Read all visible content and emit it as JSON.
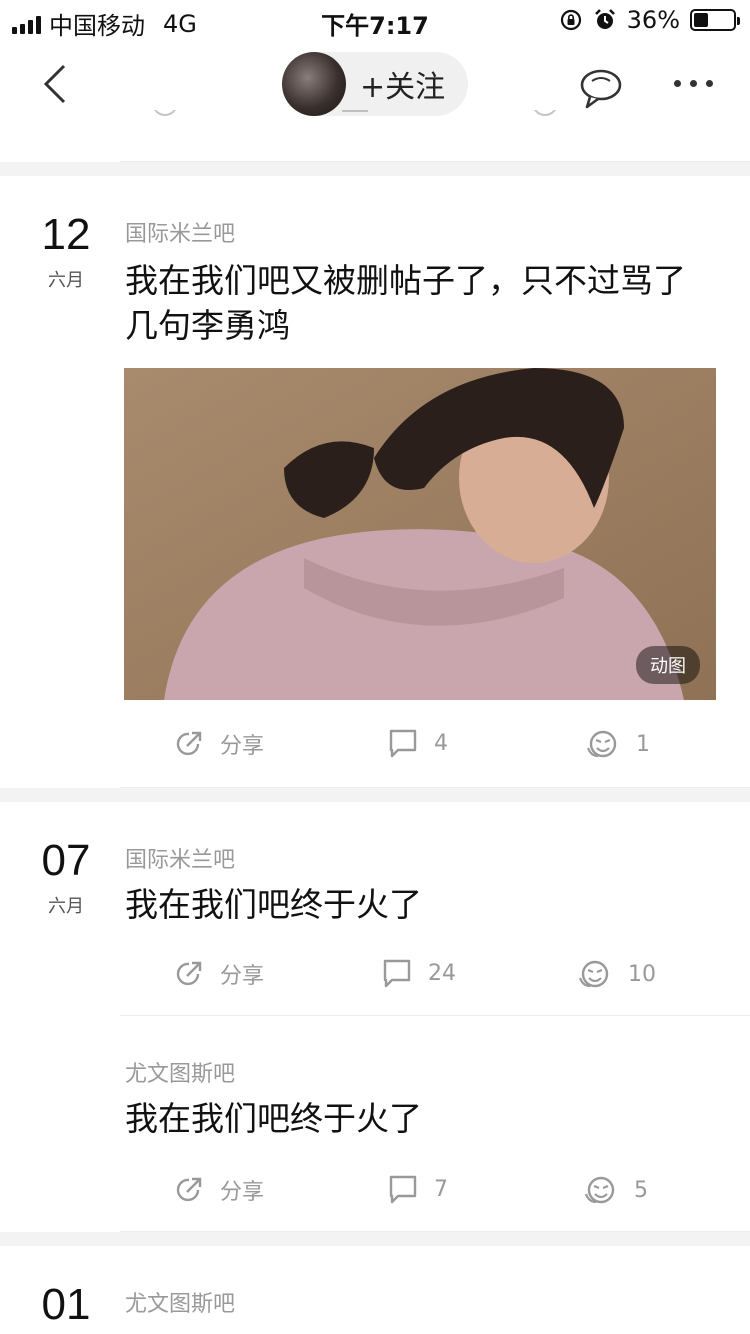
{
  "status_bar": {
    "carrier": "中国移动",
    "network": "4G",
    "time": "下午7:17",
    "battery_percent": "36%",
    "battery_level": 0.36
  },
  "nav": {
    "follow_label": "+关注",
    "icons": [
      "back-arrow-icon",
      "chat-bubble-icon",
      "more-icon"
    ]
  },
  "posts": [
    {
      "day": "12",
      "month": "六月",
      "forum": "国际米兰吧",
      "title": "我在我们吧又被删帖子了，只不过骂了几句李勇鸿",
      "gif_badge": "动图",
      "share_label": "分享",
      "comments": "4",
      "likes": "1"
    },
    {
      "day": "07",
      "month": "六月",
      "forum": "国际米兰吧",
      "title": "我在我们吧终于火了",
      "share_label": "分享",
      "comments": "24",
      "likes": "10"
    },
    {
      "forum": "尤文图斯吧",
      "title": "我在我们吧终于火了",
      "share_label": "分享",
      "comments": "7",
      "likes": "5"
    },
    {
      "day": "01",
      "forum": "尤文图斯吧"
    }
  ],
  "colors": {
    "muted_text": "#999999",
    "separator": "#f3f3f3"
  }
}
